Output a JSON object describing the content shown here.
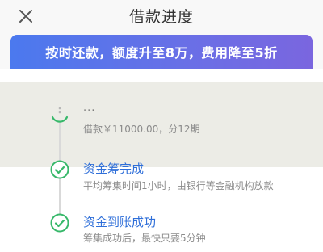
{
  "header": {
    "title": "借款进度",
    "close_icon": "close-icon"
  },
  "banner": {
    "text": "按时还款，额度升至8万，费用降至5折",
    "colors": {
      "gradient_start": "#4b79ee",
      "gradient_end": "#7a66df"
    }
  },
  "steps": [
    {
      "title": "...",
      "desc": "借款￥11000.00，分12期"
    },
    {
      "title": "资金筹完成",
      "desc": "平均筹集时间1小时，由银行等金融机构放款"
    },
    {
      "title": "资金到账成功",
      "desc": "筹集成功后，最快只要5分钟"
    }
  ],
  "colors": {
    "accent_green": "#37b86a",
    "accent_blue": "#2f6fd9",
    "text_gray": "#8b8b8b",
    "line_gray": "#d9d9d9"
  }
}
